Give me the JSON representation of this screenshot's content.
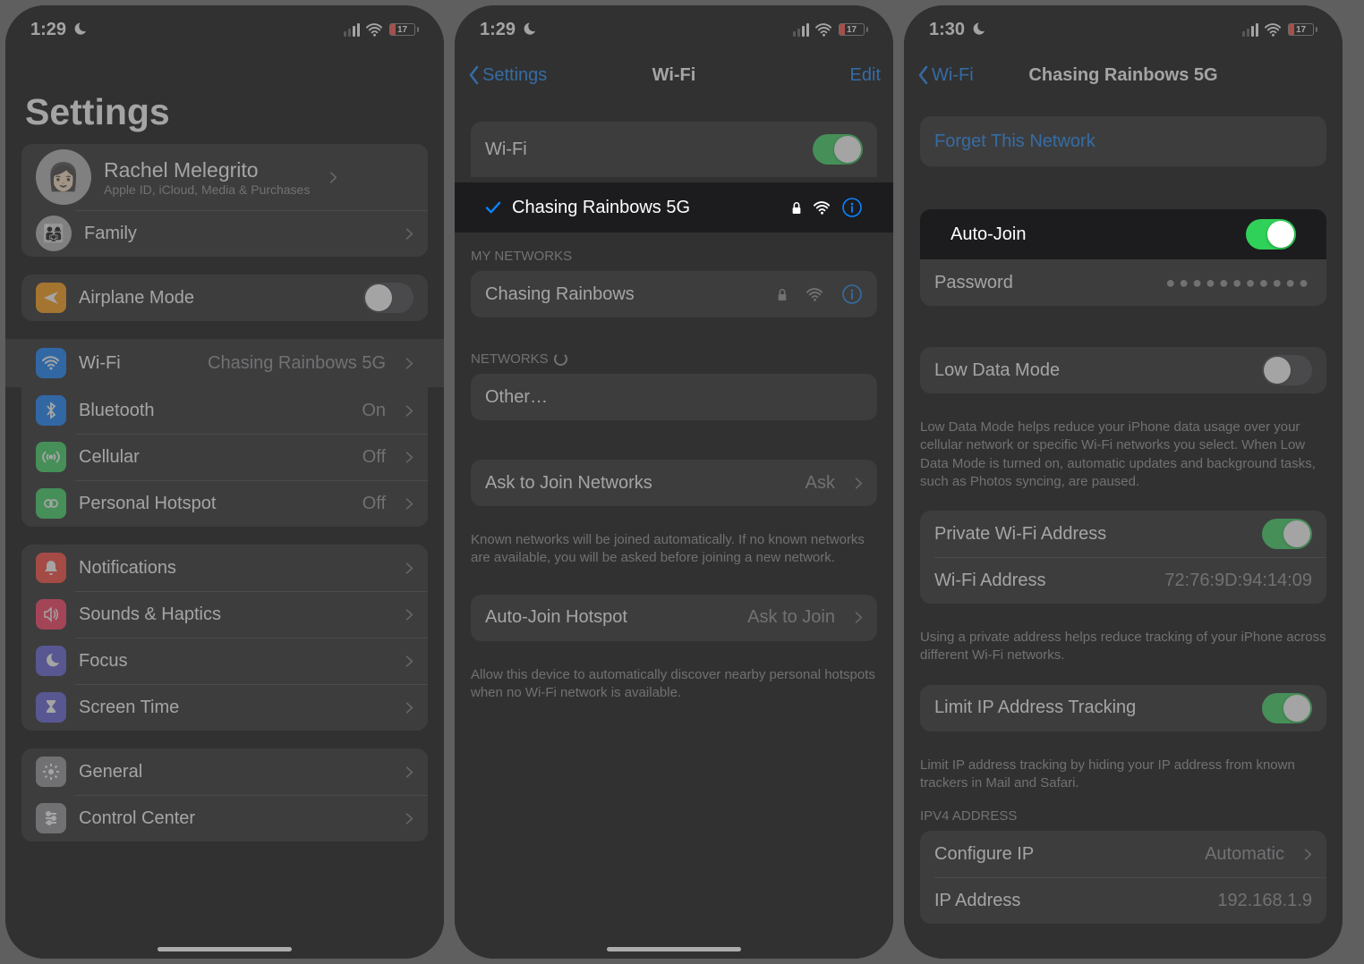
{
  "status": {
    "time": "1:29",
    "time3": "1:30",
    "battery": "17"
  },
  "s1": {
    "title": "Settings",
    "profile": {
      "name": "Rachel Melegrito",
      "sub": "Apple ID, iCloud, Media & Purchases"
    },
    "family": "Family",
    "rows": {
      "airplane": "Airplane Mode",
      "wifi": "Wi-Fi",
      "wifi_val": "Chasing Rainbows 5G",
      "bt": "Bluetooth",
      "bt_val": "On",
      "cell": "Cellular",
      "cell_val": "Off",
      "hotspot": "Personal Hotspot",
      "hotspot_val": "Off",
      "notif": "Notifications",
      "sounds": "Sounds & Haptics",
      "focus": "Focus",
      "screentime": "Screen Time",
      "general": "General",
      "cc": "Control Center"
    }
  },
  "s2": {
    "back": "Settings",
    "title": "Wi-Fi",
    "edit": "Edit",
    "wifi_label": "Wi-Fi",
    "connected": "Chasing Rainbows 5G",
    "sect_my": "MY NETWORKS",
    "net1": "Chasing Rainbows",
    "sect_net": "NETWORKS",
    "other": "Other…",
    "ask": "Ask to Join Networks",
    "ask_val": "Ask",
    "ask_foot": "Known networks will be joined automatically. If no known networks are available, you will be asked before joining a new network.",
    "auto": "Auto-Join Hotspot",
    "auto_val": "Ask to Join",
    "auto_foot": "Allow this device to automatically discover nearby personal hotspots when no Wi-Fi network is available."
  },
  "s3": {
    "back": "Wi-Fi",
    "title": "Chasing Rainbows 5G",
    "forget": "Forget This Network",
    "autojoin": "Auto-Join",
    "password": "Password",
    "pw_val": "●●●●●●●●●●●",
    "lowdata": "Low Data Mode",
    "lowdata_foot": "Low Data Mode helps reduce your iPhone data usage over your cellular network or specific Wi-Fi networks you select. When Low Data Mode is turned on, automatic updates and background tasks, such as Photos syncing, are paused.",
    "priv": "Private Wi-Fi Address",
    "addr": "Wi-Fi Address",
    "addr_val": "72:76:9D:94:14:09",
    "priv_foot": "Using a private address helps reduce tracking of your iPhone across different Wi-Fi networks.",
    "limit": "Limit IP Address Tracking",
    "limit_foot": "Limit IP address tracking by hiding your IP address from known trackers in Mail and Safari.",
    "ipv4": "IPV4 ADDRESS",
    "cfg": "Configure IP",
    "cfg_val": "Automatic",
    "ip": "IP Address",
    "ip_val": "192.168.1.9"
  }
}
